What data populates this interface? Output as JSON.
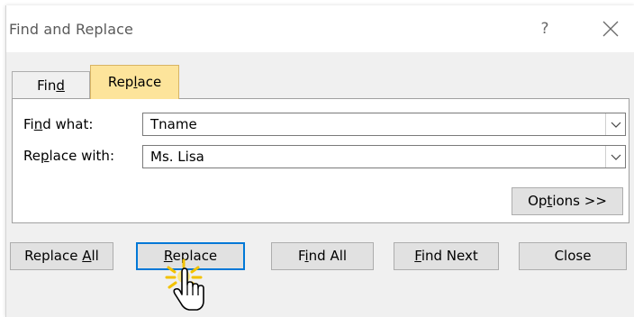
{
  "window": {
    "title": "Find and Replace",
    "help": "?"
  },
  "tabs": [
    {
      "pre": "Fin",
      "key": "d",
      "post": ""
    },
    {
      "pre": "Rep",
      "key": "l",
      "post": "ace"
    }
  ],
  "fields": {
    "find_label": {
      "pre": "Fi",
      "key": "n",
      "post": "d what:"
    },
    "find_value": "Tname",
    "replace_label": {
      "pre": "Re",
      "key": "p",
      "post": "lace with:"
    },
    "replace_value": "Ms. Lisa"
  },
  "options_button": {
    "pre": "Op",
    "key": "t",
    "post": "ions >>"
  },
  "buttons": {
    "replace_all": {
      "pre": "Replace ",
      "key": "A",
      "post": "ll"
    },
    "replace": {
      "pre": "",
      "key": "R",
      "post": "eplace"
    },
    "find_all": {
      "pre": "F",
      "key": "i",
      "post": "nd All"
    },
    "find_next": {
      "pre": "",
      "key": "F",
      "post": "ind Next"
    },
    "close": "Close"
  },
  "colors": {
    "active_tab": "#fde49b",
    "focus_border": "#0078d7"
  },
  "icons": [
    "close-icon",
    "dropdown-arrow-icon",
    "hand-cursor-icon"
  ]
}
